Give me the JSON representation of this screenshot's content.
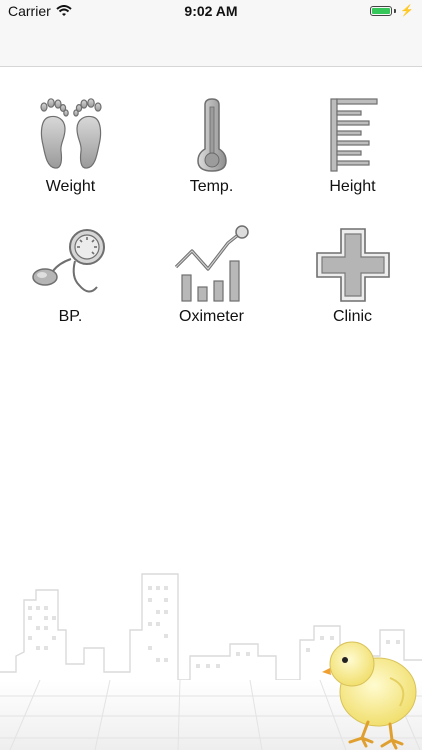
{
  "status_bar": {
    "carrier": "Carrier",
    "time": "9:02 AM",
    "wifi_icon": "wifi-icon",
    "battery_icon": "battery-charging-icon",
    "battery_color": "#35c759"
  },
  "menu": {
    "items": [
      {
        "label": "Weight",
        "icon": "feet-icon"
      },
      {
        "label": "Temp.",
        "icon": "thermometer-icon"
      },
      {
        "label": "Height",
        "icon": "height-ruler-icon"
      },
      {
        "label": "BP.",
        "icon": "blood-pressure-icon"
      },
      {
        "label": "Oximeter",
        "icon": "oximeter-chart-icon"
      },
      {
        "label": "Clinic",
        "icon": "medical-cross-icon"
      }
    ]
  },
  "theme": {
    "icon_fill": "#b8b8b8",
    "icon_stroke": "#6f6f6f",
    "skyline_color": "#dcdcdc",
    "chick_color": "#f5ea8a"
  }
}
